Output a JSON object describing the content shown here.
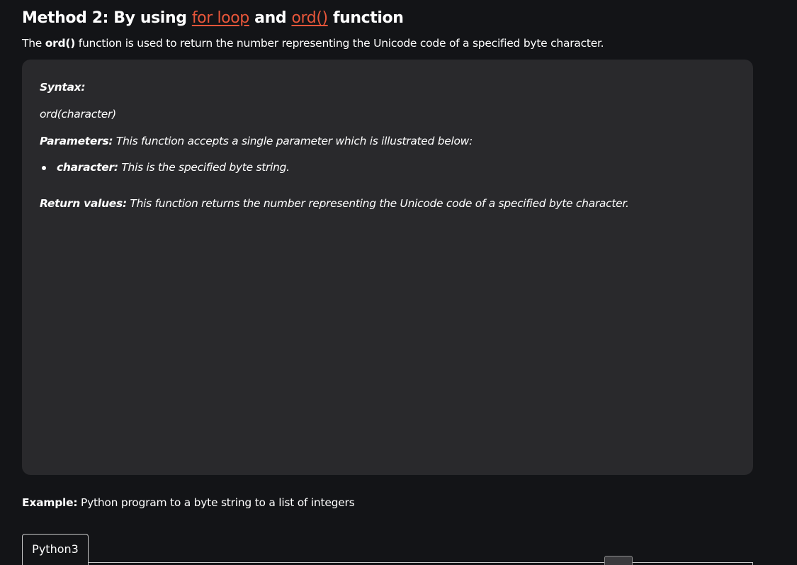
{
  "heading": {
    "prefix": "Method 2: By using ",
    "link1": "for loop",
    "middle": " and ",
    "link2": "ord()",
    "suffix": " function",
    "link_color": "#e8563a"
  },
  "intro": {
    "before": "The ",
    "code": "ord()",
    "after": " function is used to return the number representing the Unicode code of a specified byte character."
  },
  "syntax_box": {
    "syntax_label": "Syntax:",
    "syntax_code": "ord(character)",
    "parameters_label": "Parameters:",
    "parameters_text": " This function accepts a single parameter which is illustrated below:",
    "param_name": "character:",
    "param_desc": " This is the specified byte string.",
    "return_label": "Return values:",
    "return_text": " This function returns the number representing the Unicode code of a specified byte character."
  },
  "example": {
    "label": "Example:",
    "text": " Python program to a byte string to a list of integers"
  },
  "code_tabs": {
    "active_tab": "Python3"
  }
}
